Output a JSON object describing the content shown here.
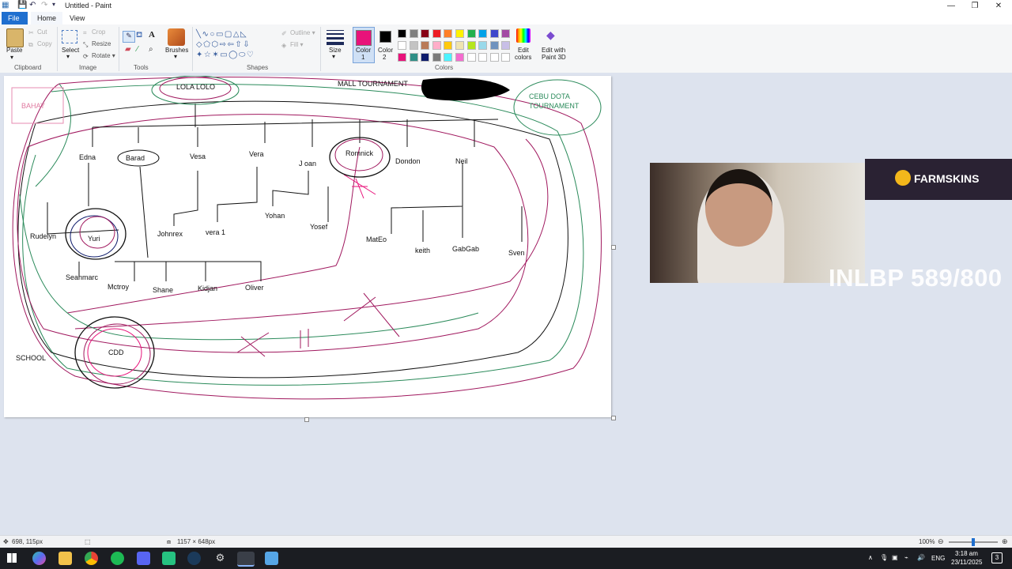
{
  "window": {
    "title": "Untitled - Paint",
    "controls": {
      "minimize": "—",
      "restore": "❐",
      "close": "✕"
    }
  },
  "menu": {
    "file": "File",
    "home": "Home",
    "view": "View"
  },
  "ribbon": {
    "clipboard": {
      "group": "Clipboard",
      "paste": "Paste",
      "cut": "Cut",
      "copy": "Copy"
    },
    "image": {
      "group": "Image",
      "select": "Select",
      "crop": "Crop",
      "resize": "Resize",
      "rotate": "Rotate"
    },
    "tools": {
      "group": "Tools"
    },
    "brushes": "Brushes",
    "shapes": {
      "group": "Shapes",
      "outline": "Outline",
      "fill": "Fill"
    },
    "size": "Size",
    "colors": {
      "group": "Colors",
      "color1": "Color",
      "color1_num": "1",
      "color2": "Color",
      "color2_num": "2",
      "edit_colors": "Edit",
      "edit_colors_2": "colors",
      "edit_paint3d": "Edit with",
      "edit_paint3d_2": "Paint 3D",
      "color1_value": "#e8127a",
      "color2_value": "#000000",
      "palette_row1": [
        "#000000",
        "#7f7f7f",
        "#880015",
        "#ed1c24",
        "#ff7f27",
        "#fff200",
        "#22b14c",
        "#00a2e8",
        "#3f48cc",
        "#a349a4"
      ],
      "palette_row2": [
        "#ffffff",
        "#c3c3c3",
        "#b97a57",
        "#ffaec9",
        "#ffc90e",
        "#efe4b0",
        "#b5e61d",
        "#99d9ea",
        "#7092be",
        "#c8bfe7"
      ],
      "palette_row3": [
        "#e8127a",
        "#2f8f86",
        "#0d1b6b",
        "#7a7a7a",
        "#4df3ff",
        "#f46ccf",
        "#ffffff",
        "#ffffff",
        "#ffffff",
        "#ffffff"
      ]
    }
  },
  "canvas_labels": {
    "lola": "LOLA LOLO",
    "mall": "MALL TOURNAMENT",
    "bahay": "BAHAY",
    "cebu1": "CEBU DOTA",
    "cebu2": "TOURNAMENT",
    "edna": "Edna",
    "barad": "Barad",
    "vesa": "Vesa",
    "vera": "Vera",
    "joan": "J oan",
    "romnick": "Romnick",
    "dondon": "Dondon",
    "neil": "Neil",
    "rudelyn": "Rudelyn",
    "yuri": "Yuri",
    "johnrex": "Johnrex",
    "vera1": "vera 1",
    "yohan": "Yohan",
    "yosef": "Yosef",
    "mateo": "MatEo",
    "keith": "keith",
    "gabgab": "GabGab",
    "sven": "Sven",
    "seanmarc": "Seanmarc",
    "mctroy": "Mctroy",
    "shane": "Shane",
    "kidjan": "Kidjan",
    "oliver": "Oliver",
    "cdd": "CDD",
    "school": "SCHOOL"
  },
  "overlay": {
    "farmskins": "FARMSKINS",
    "bp": "INLBP 589/800"
  },
  "status": {
    "cursor": "698, 115px",
    "size": "1157 × 648px",
    "zoom": "100%"
  },
  "taskbar": {
    "lang": "ENG",
    "time": "3:18 am",
    "date": "23/11/2025",
    "notif": "3"
  }
}
